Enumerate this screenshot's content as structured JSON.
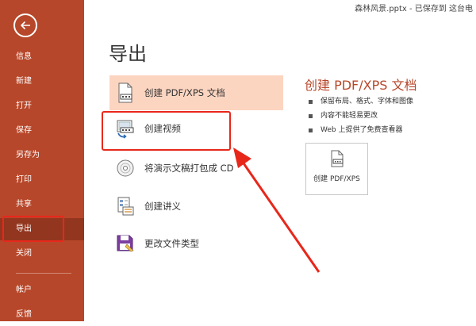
{
  "window": {
    "title_text": "森林风景.pptx  -  已保存到 这台电"
  },
  "sidebar": {
    "back_icon": "back-arrow-icon",
    "items": [
      {
        "label": "信息"
      },
      {
        "label": "新建"
      },
      {
        "label": "打开"
      },
      {
        "label": "保存"
      },
      {
        "label": "另存为"
      },
      {
        "label": "打印"
      },
      {
        "label": "共享"
      },
      {
        "label": "导出",
        "active": true
      },
      {
        "label": "关闭"
      },
      {
        "label": "帐户"
      },
      {
        "label": "反馈"
      }
    ]
  },
  "main": {
    "title": "导出",
    "options": [
      {
        "label": "创建 PDF/XPS 文档",
        "icon": "pdf-document-icon",
        "selected": true
      },
      {
        "label": "创建视频",
        "icon": "video-icon"
      },
      {
        "label": "将演示文稿打包成 CD",
        "icon": "cd-icon"
      },
      {
        "label": "创建讲义",
        "icon": "handout-icon"
      },
      {
        "label": "更改文件类型",
        "icon": "save-floppy-icon"
      }
    ]
  },
  "detail": {
    "title": "创建 PDF/XPS 文档",
    "bullets": [
      "保留布局、格式、字体和图像",
      "内容不能轻易更改",
      "Web 上提供了免费查看器"
    ],
    "button_label": "创建 PDF/XPS"
  },
  "colors": {
    "sidebar": "#b7472a",
    "sidebar_active": "#93361f",
    "selected_option": "#fcd5c1",
    "accent": "#b7472a",
    "annotation": "#e8271b"
  }
}
